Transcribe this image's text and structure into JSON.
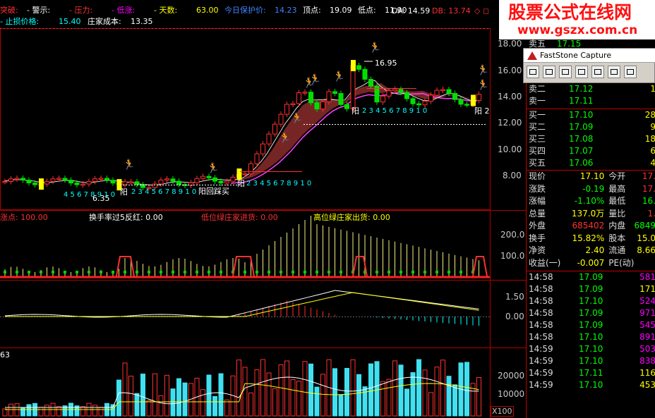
{
  "header": {
    "items": [
      {
        "text": "突破:",
        "color": "#ff3030"
      },
      {
        "text": "- 警示:",
        "color": "#ffffff"
      },
      {
        "text": "- 压力:",
        "color": "#ff3030"
      },
      {
        "text": "- 低涨:",
        "color": "#ff00ff"
      },
      {
        "text": "- 天数:",
        "color": "#ffff00"
      },
      {
        "text": "63.00",
        "color": "#ffff00"
      },
      {
        "text": "今日保护价:",
        "color": "#4080ff"
      },
      {
        "text": "14.23",
        "color": "#4080ff"
      },
      {
        "text": "顶点:",
        "color": "#ffffff"
      },
      {
        "text": "19.09",
        "color": "#ffffff"
      },
      {
        "text": "低点:",
        "color": "#ffffff"
      },
      {
        "text": "11.90",
        "color": "#ffffff"
      }
    ],
    "da": "DA: 14.59",
    "db": "DB: 13.74",
    "line2": [
      {
        "text": "- 止损价格:",
        "color": "#00ffff"
      },
      {
        "text": "15.40",
        "color": "#00ffff"
      },
      {
        "text": "庄家成本:",
        "color": "#ffffff"
      },
      {
        "text": "13.35",
        "color": "#ffffff"
      }
    ]
  },
  "watermark": {
    "title": "股票公式在线网",
    "url": "www.gszx.com.cn"
  },
  "main_panel": {
    "price_axis": [
      "18.00",
      "16.00",
      "14.00",
      "12.00",
      "10.00",
      "8.00"
    ],
    "peak_label": "16.95",
    "low_label": "6.35",
    "counters": [
      "4 5 6 7 8 9 1 0",
      "2 3 4 5 6 7 8 9 1 0",
      "2 3 4 5 6 7 8 9 1 0",
      "2 3 4 5 6 7 8 9 1 0"
    ],
    "yang_labels": [
      "阳",
      "阳",
      "阳",
      "阳"
    ],
    "sun_text": "阳回踩买",
    "last_yang": "阳 2"
  },
  "indicator1": {
    "header": [
      {
        "text": "涨点: 100.00",
        "color": "#ff3030"
      },
      {
        "text": "换手率过5反红: 0.00",
        "color": "#ffffff"
      },
      {
        "text": "低位绿庄家进货: 0.00",
        "color": "#ff3030"
      },
      {
        "text": "高位绿庄家出货: 0.00",
        "color": "#ffff00"
      }
    ],
    "axis": [
      "200.0",
      "100.0"
    ]
  },
  "indicator2": {
    "axis": [
      "1.50",
      "0.00"
    ]
  },
  "volume_panel": {
    "label": "63",
    "axis": [
      "20000",
      "10000"
    ],
    "unit": "X100"
  },
  "fastcapture": {
    "title": "FastStone Capture",
    "tools": [
      "window-icon",
      "region-icon",
      "rect-icon",
      "freehand-icon",
      "fullscreen-icon",
      "scroll-icon",
      "settings-icon"
    ]
  },
  "quote": {
    "top_partial": {
      "label": "卖五",
      "price": "17.15",
      "vol": "4"
    },
    "sells": [
      {
        "label": "卖二",
        "price": "17.12",
        "vol": "1"
      },
      {
        "label": "卖一",
        "price": "17.11",
        "vol": ""
      }
    ],
    "buys": [
      {
        "label": "买一",
        "price": "17.10",
        "vol": "28"
      },
      {
        "label": "买二",
        "price": "17.09",
        "vol": "9"
      },
      {
        "label": "买三",
        "price": "17.08",
        "vol": "18"
      },
      {
        "label": "买四",
        "price": "17.07",
        "vol": "6"
      },
      {
        "label": "买五",
        "price": "17.06",
        "vol": "4"
      }
    ],
    "stats": [
      {
        "l1": "现价",
        "v1": "17.10",
        "c1": "#ffff00",
        "l2": "今开",
        "v2": "17.",
        "c2": "#ff3030"
      },
      {
        "l1": "涨跌",
        "v1": "-0.19",
        "c1": "#00ff00",
        "l2": "最高",
        "v2": "17.",
        "c2": "#ff3030"
      },
      {
        "l1": "涨幅",
        "v1": "-1.10%",
        "c1": "#00ff00",
        "l2": "最低",
        "v2": "16.",
        "c2": "#00ff00"
      },
      {
        "l1": "总量",
        "v1": "137.0万",
        "c1": "#ffff00",
        "l2": "量比",
        "v2": "1.",
        "c2": "#ff3030"
      },
      {
        "l1": "外盘",
        "v1": "685402",
        "c1": "#ff3030",
        "l2": "内盘",
        "v2": "6849",
        "c2": "#00ff00"
      },
      {
        "l1": "换手",
        "v1": "15.82%",
        "c1": "#ffff00",
        "l2": "股本",
        "v2": "15.0",
        "c2": "#ffff00"
      },
      {
        "l1": "净资",
        "v1": "2.40",
        "c1": "#ffff00",
        "l2": "流通",
        "v2": "8.66",
        "c2": "#ffff00"
      },
      {
        "l1": "收益(一)",
        "v1": "-0.007",
        "c1": "#ffff00",
        "l2": "PE(动)",
        "v2": "",
        "c2": "#ffff00"
      }
    ],
    "ticks": [
      {
        "time": "14:58",
        "price": "17.09",
        "vol": "581",
        "color": "#ff00ff"
      },
      {
        "time": "14:58",
        "price": "17.09",
        "vol": "171",
        "color": "#ffff00"
      },
      {
        "time": "14:58",
        "price": "17.10",
        "vol": "524",
        "color": "#ff00ff"
      },
      {
        "time": "14:58",
        "price": "17.09",
        "vol": "971",
        "color": "#ff00ff"
      },
      {
        "time": "14:58",
        "price": "17.09",
        "vol": "545",
        "color": "#ff00ff"
      },
      {
        "time": "14:58",
        "price": "17.10",
        "vol": "891",
        "color": "#ff00ff"
      },
      {
        "time": "14:59",
        "price": "17.10",
        "vol": "503",
        "color": "#ff00ff"
      },
      {
        "time": "14:59",
        "price": "17.10",
        "vol": "838",
        "color": "#ff00ff"
      },
      {
        "time": "14:59",
        "price": "17.11",
        "vol": "116",
        "color": "#ffff00"
      },
      {
        "time": "14:59",
        "price": "17.10",
        "vol": "453",
        "color": "#ffff00"
      }
    ]
  }
}
